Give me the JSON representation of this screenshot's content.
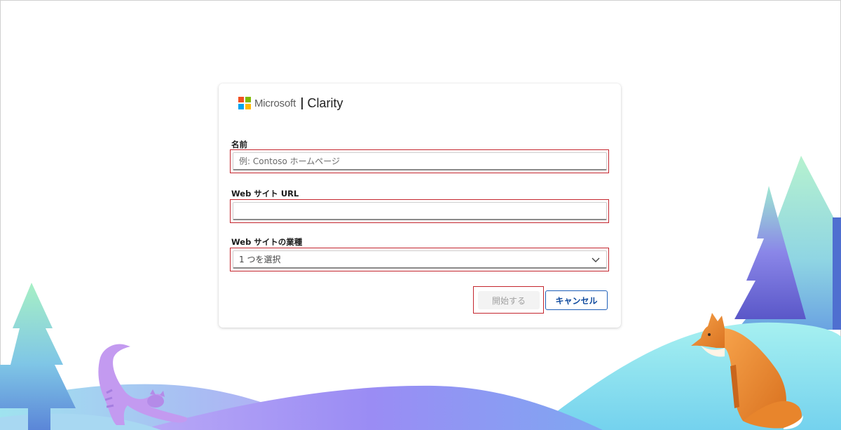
{
  "brand": {
    "microsoft": "Microsoft",
    "product": "Clarity"
  },
  "form": {
    "name_label": "名前",
    "name_placeholder": "例: Contoso ホームページ",
    "name_value": "",
    "url_label": "Web サイト URL",
    "url_placeholder": "",
    "url_value": "",
    "category_label": "Web サイトの業種",
    "category_value": "1 つを選択"
  },
  "actions": {
    "start_label": "開始する",
    "cancel_label": "キャンセル"
  },
  "colors": {
    "highlight": "#c4262e",
    "accent": "#0f4a9e",
    "logo": [
      "#f25022",
      "#7fba00",
      "#00a4ef",
      "#ffb900"
    ]
  },
  "icons": {
    "category_dropdown": "chevron-down-icon"
  }
}
